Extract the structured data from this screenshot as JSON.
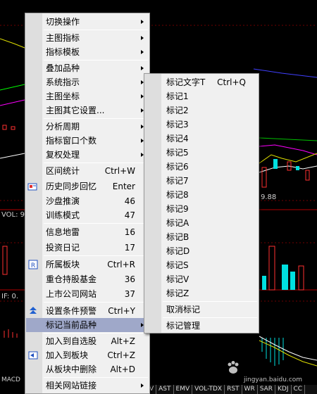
{
  "background": {
    "vol_label": "VOL: 9",
    "if_label": "IF: 0.",
    "macd_label": "MACD",
    "price_label": "9.88",
    "indicators": [
      "OBV",
      "AST",
      "EMV",
      "VOL-TDX",
      "RST",
      "WR",
      "SAR",
      "KDJ",
      "CC"
    ]
  },
  "main_menu": {
    "items": [
      {
        "label": "切换操作",
        "shortcut": "",
        "submenu": true
      },
      {
        "label": "主图指标",
        "shortcut": "",
        "submenu": true
      },
      {
        "label": "指标模板",
        "shortcut": "",
        "submenu": true
      },
      {
        "label": "叠加品种",
        "shortcut": "",
        "submenu": true
      },
      {
        "label": "系统指示",
        "shortcut": "",
        "submenu": true
      },
      {
        "label": "主图坐标",
        "shortcut": "",
        "submenu": true
      },
      {
        "label": "主图其它设置...",
        "shortcut": "",
        "submenu": true
      },
      {
        "label": "分析周期",
        "shortcut": "",
        "submenu": true
      },
      {
        "label": "指标窗口个数",
        "shortcut": "",
        "submenu": true
      },
      {
        "label": "复权处理",
        "shortcut": "",
        "submenu": true
      },
      {
        "label": "区间统计",
        "shortcut": "Ctrl+W",
        "submenu": false
      },
      {
        "label": "历史同步回忆",
        "shortcut": "Enter",
        "submenu": false
      },
      {
        "label": "沙盘推演",
        "shortcut": "46",
        "submenu": false
      },
      {
        "label": "训练模式",
        "shortcut": "47",
        "submenu": false
      },
      {
        "label": "信息地雷",
        "shortcut": "16",
        "submenu": false
      },
      {
        "label": "投资日记",
        "shortcut": "17",
        "submenu": false
      },
      {
        "label": "所属板块",
        "shortcut": "Ctrl+R",
        "submenu": false
      },
      {
        "label": "重仓持股基金",
        "shortcut": "36",
        "submenu": false
      },
      {
        "label": "上市公司网站",
        "shortcut": "37",
        "submenu": false
      },
      {
        "label": "设置条件预警",
        "shortcut": "Ctrl+Y",
        "submenu": false
      },
      {
        "label": "标记当前品种",
        "shortcut": "",
        "submenu": true
      },
      {
        "label": "加入到自选股",
        "shortcut": "Alt+Z",
        "submenu": false
      },
      {
        "label": "加入到板块",
        "shortcut": "Ctrl+Z",
        "submenu": false
      },
      {
        "label": "从板块中删除",
        "shortcut": "Alt+D",
        "submenu": false
      },
      {
        "label": "相关网站链接",
        "shortcut": "",
        "submenu": true
      }
    ]
  },
  "sub_menu": {
    "items": [
      {
        "label": "标记文字T",
        "shortcut": "Ctrl+Q"
      },
      {
        "label": "标记1",
        "shortcut": ""
      },
      {
        "label": "标记2",
        "shortcut": ""
      },
      {
        "label": "标记3",
        "shortcut": ""
      },
      {
        "label": "标记4",
        "shortcut": ""
      },
      {
        "label": "标记5",
        "shortcut": ""
      },
      {
        "label": "标记6",
        "shortcut": ""
      },
      {
        "label": "标记7",
        "shortcut": ""
      },
      {
        "label": "标记8",
        "shortcut": ""
      },
      {
        "label": "标记9",
        "shortcut": ""
      },
      {
        "label": "标记A",
        "shortcut": ""
      },
      {
        "label": "标记B",
        "shortcut": ""
      },
      {
        "label": "标记D",
        "shortcut": ""
      },
      {
        "label": "标记S",
        "shortcut": ""
      },
      {
        "label": "标记V",
        "shortcut": ""
      },
      {
        "label": "标记Z",
        "shortcut": ""
      },
      {
        "label": "取消标记",
        "shortcut": ""
      },
      {
        "label": "标记管理",
        "shortcut": ""
      }
    ]
  },
  "watermark": "jingyan.baidu.com",
  "colors": {
    "highlight": "#9fa8c9",
    "menu_bg": "#f0f0f0",
    "chart_bg": "#000000"
  }
}
